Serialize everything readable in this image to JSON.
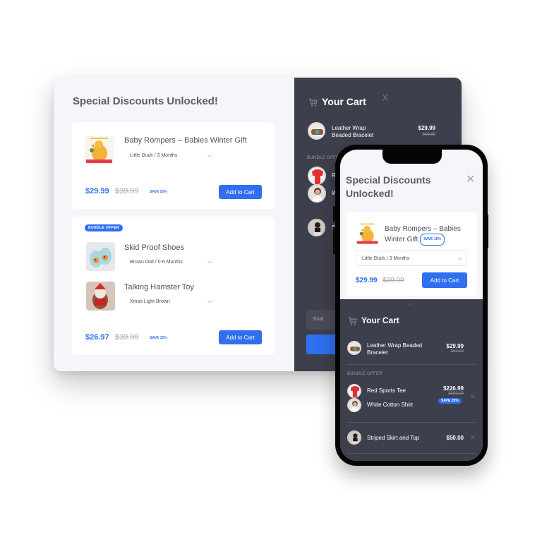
{
  "desktop": {
    "offers_title": "Special Discounts Unlocked!",
    "offers": [
      {
        "bundle": false,
        "items": [
          {
            "name": "Baby Rompers – Babies Winter Gift",
            "variant": "Little Duck / 3 Months",
            "thumb": "duck-romper"
          }
        ],
        "price": "$29.99",
        "old_price": "$39.99",
        "save": "SAVE 25%",
        "button": "Add to Cart"
      },
      {
        "bundle": true,
        "badge": "BUNDLE OFFER",
        "items": [
          {
            "name": "Skid Proof Shoes",
            "variant": "Brown Owl / 0-6 Months",
            "thumb": "baby-shoes"
          },
          {
            "name": "Talking Hamster Toy",
            "variant": "Xmas Light Brown",
            "thumb": "hamster-toy"
          }
        ],
        "price": "$26.97",
        "old_price": "$39.99",
        "save": "SAVE 15%",
        "button": "Add to Cart"
      }
    ],
    "cart": {
      "title": "Your Cart",
      "close": "X",
      "items": [
        {
          "name_line1": "Leather Wrap",
          "name_line2": "Beaded Bracelet",
          "price": "$29.99",
          "old_price": "$69.99"
        }
      ],
      "bundle_label": "BUNDLE OFFER",
      "bundle_initials": [
        "R",
        "W"
      ],
      "single_initial": "S",
      "total_label": "Total"
    }
  },
  "mobile": {
    "title_line1": "Special Discounts",
    "title_line2": "Unlocked!",
    "close": "✕",
    "offer": {
      "name_line1": "Baby Rompers – Babies",
      "name_line2": "Winter Gift",
      "save": "SAVE 15%",
      "variant": "Little Duck / 3 Months",
      "price": "$29.99",
      "old_price": "$39.99",
      "button": "Add to Cart"
    },
    "cart": {
      "handle": "⌄",
      "title": "Your Cart",
      "items": [
        {
          "name_line1": "Leather Wrap Beaded",
          "name_line2": "Bracelet",
          "price": "$29.99",
          "old_price": "$69.99"
        }
      ],
      "bundle_label": "BUNDLE OFFER",
      "bundle": {
        "items": [
          "Red Sports Tee",
          "White Cotton Shirt"
        ],
        "price": "$226.99",
        "old_price": "$399.99",
        "save": "SAVE 25%"
      },
      "single": {
        "name": "Striped Skirt and Top",
        "price": "$50.00"
      },
      "remove": "✕"
    }
  },
  "colors": {
    "accent": "#2f6ff0",
    "cart_bg": "#3e3f4c",
    "modal_bg": "#f5f6fa",
    "title_text": "#5b5c66"
  }
}
